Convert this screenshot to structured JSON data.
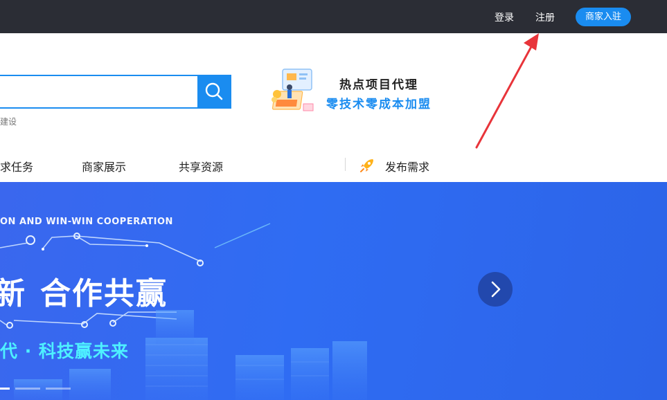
{
  "topbar": {
    "login": "登录",
    "register": "注册",
    "merchant_join": "商家入驻"
  },
  "search": {
    "hint": "建设"
  },
  "promo": {
    "line1": "热点项目代理",
    "line2": "零技术零成本加盟"
  },
  "nav": {
    "items": [
      "求任务",
      "商家展示",
      "共享资源"
    ],
    "publish": "发布需求"
  },
  "banner": {
    "english": "ON AND WIN-WIN COOPERATION",
    "big_left": "新",
    "big_right": "合作共赢",
    "sub": "代 · 科技赢未来"
  },
  "colors": {
    "topbar": "#2b2d35",
    "accent": "#1a8cf0",
    "banner": "#2f6cf3",
    "banner_sub": "#4ef0ff",
    "annotation": "#e8343a"
  }
}
